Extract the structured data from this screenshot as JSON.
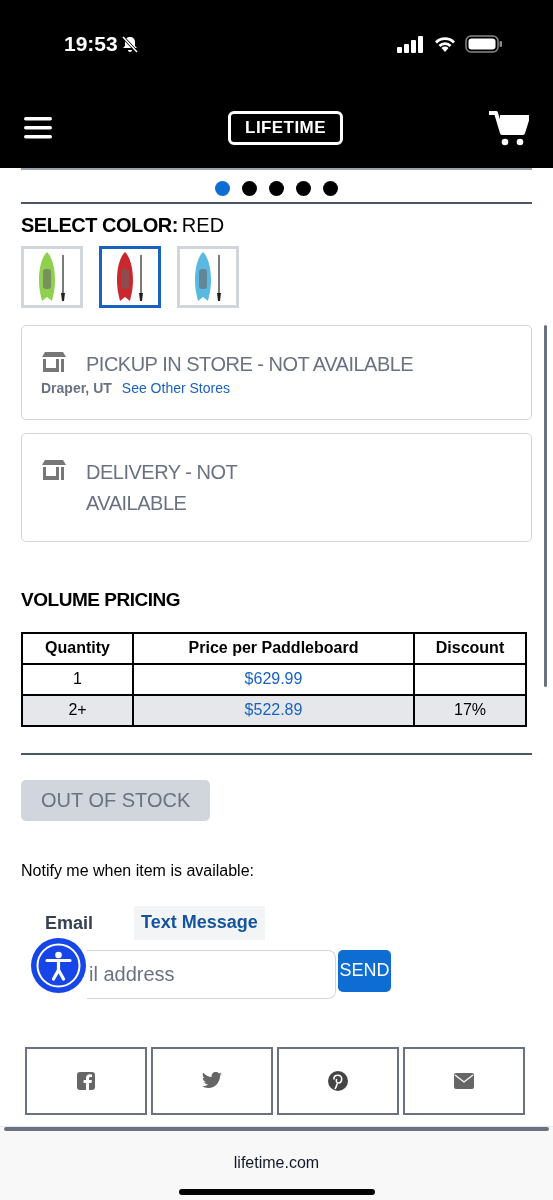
{
  "status_bar": {
    "time": "19:53"
  },
  "header": {
    "logo": "LIFETIME"
  },
  "carousel": {
    "dots": [
      {
        "selected": true
      },
      {
        "selected": false
      },
      {
        "selected": false
      },
      {
        "selected": false
      },
      {
        "selected": false
      }
    ]
  },
  "color_select": {
    "label": "SELECT COLOR:",
    "value": "RED",
    "swatches": [
      {
        "color": "#8fd14f",
        "selected": false
      },
      {
        "color": "#c8282e",
        "selected": true
      },
      {
        "color": "#5bb8e0",
        "selected": false
      }
    ]
  },
  "availability": [
    {
      "title": "PICKUP IN STORE - NOT AVAILABLE",
      "location": "Draper, UT",
      "link": "See Other Stores"
    },
    {
      "title": "DELIVERY - NOT AVAILABLE"
    }
  ],
  "volume_pricing": {
    "title": "VOLUME PRICING",
    "columns": [
      "Quantity",
      "Price per Paddleboard",
      "Discount"
    ],
    "rows": [
      [
        "1",
        "$629.99",
        ""
      ],
      [
        "2+",
        "$522.89",
        "17%"
      ]
    ]
  },
  "stock_button": {
    "label": "OUT OF STOCK",
    "disabled": true
  },
  "notify": {
    "text": "Notify me when item is available:",
    "tabs": [
      {
        "label": "Email",
        "selected": false
      },
      {
        "label": "Text Message",
        "selected": true
      }
    ],
    "field": {
      "placeholder": "il address"
    },
    "send": "SEND"
  },
  "share": [
    {
      "kind": "facebook"
    },
    {
      "kind": "twitter"
    },
    {
      "kind": "pinterest"
    },
    {
      "kind": "email"
    }
  ],
  "browser": {
    "url": "lifetime.com"
  }
}
